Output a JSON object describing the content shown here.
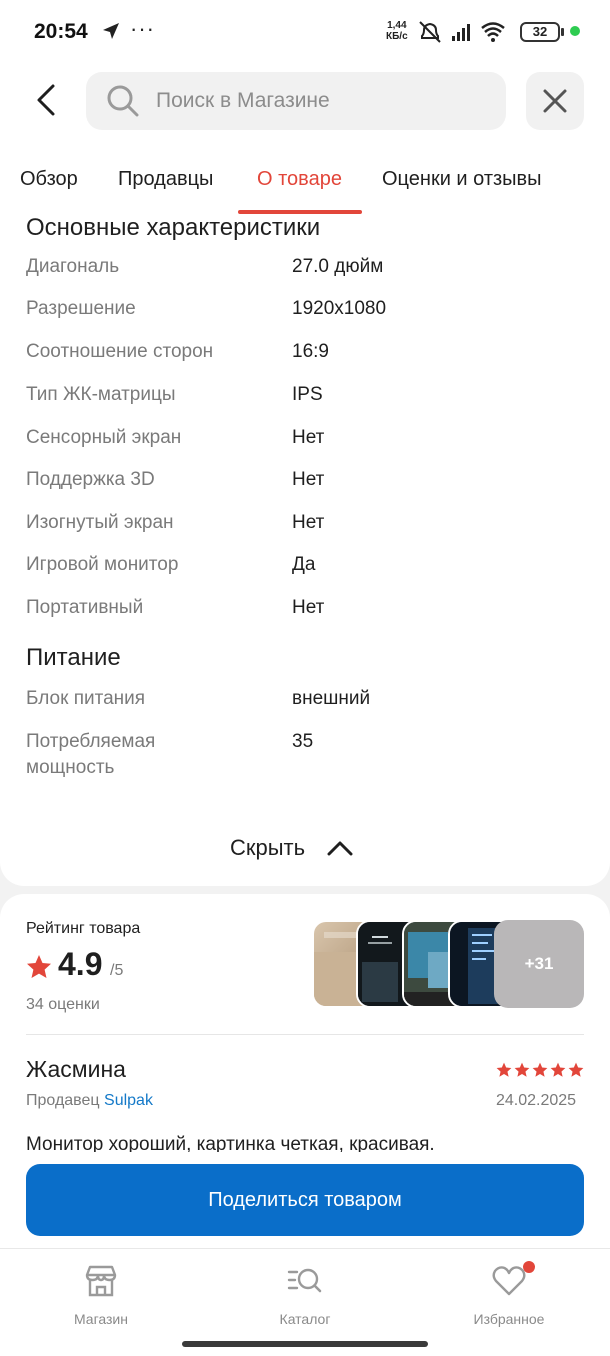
{
  "status_bar": {
    "time": "20:54",
    "more": "···",
    "speed_value": "1,44",
    "speed_unit": "КБ/с",
    "battery": "32"
  },
  "header": {
    "search_placeholder": "Поиск в Магазине"
  },
  "tabs": [
    {
      "label": "Обзор"
    },
    {
      "label": "Продавцы"
    },
    {
      "label": "О товаре"
    },
    {
      "label": "Оценки и отзывы"
    }
  ],
  "active_tab_index": 2,
  "specs": {
    "main_title": "Основные характеристики",
    "main_rows": [
      {
        "label": "Диагональ",
        "value": "27.0 дюйм"
      },
      {
        "label": "Разрешение",
        "value": "1920x1080"
      },
      {
        "label": "Соотношение сторон",
        "value": "16:9"
      },
      {
        "label": "Тип ЖК-матрицы",
        "value": "IPS"
      },
      {
        "label": "Сенсорный экран",
        "value": "Нет"
      },
      {
        "label": "Поддержка 3D",
        "value": "Нет"
      },
      {
        "label": "Изогнутый экран",
        "value": "Нет"
      },
      {
        "label": "Игровой монитор",
        "value": "Да"
      },
      {
        "label": "Портативный",
        "value": "Нет"
      }
    ],
    "power_title": "Питание",
    "power_rows": [
      {
        "label": "Блок питания",
        "value": "внешний"
      },
      {
        "label": "Потребляемая мощность",
        "value": "35"
      }
    ],
    "hide_label": "Скрыть"
  },
  "rating": {
    "title": "Рейтинг товара",
    "value": "4.9",
    "max": "/5",
    "count": "34 оценки",
    "more_photos": "+31",
    "star_color": "#e2463a"
  },
  "review": {
    "author": "Жасмина",
    "stars": 5,
    "seller_prefix": "Продавец",
    "seller_name": "Sulpak",
    "date": "24.02.2025",
    "text": "Монитор хороший, картинка четкая, красивая."
  },
  "share_button": "Поделиться товаром",
  "bottom_nav": [
    {
      "label": "Магазин",
      "icon": "store-icon"
    },
    {
      "label": "Каталог",
      "icon": "catalog-search-icon"
    },
    {
      "label": "Избранное",
      "icon": "heart-icon"
    }
  ],
  "colors": {
    "accent": "#e2463a",
    "primary_button": "#0a6ec9",
    "seller_link": "#1479c8"
  }
}
